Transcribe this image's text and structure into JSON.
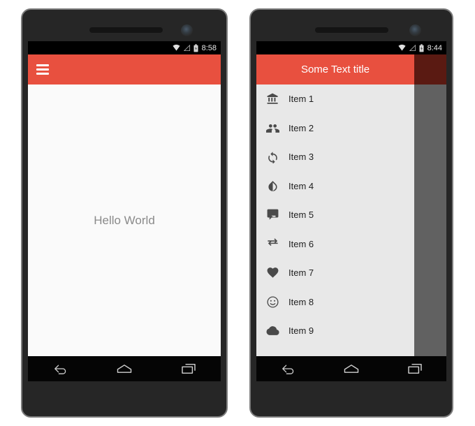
{
  "phones": [
    {
      "id": "phone-left",
      "status_bar": {
        "clock": "8:58",
        "icons": [
          "wifi-icon",
          "signal-icon",
          "battery-icon"
        ]
      },
      "app_bar": {
        "nav_icon": "hamburger-menu-icon",
        "title": ""
      },
      "content": {
        "text": "Hello World"
      },
      "nav_bar": {
        "back": "back-icon",
        "home": "home-icon",
        "recents": "recents-icon"
      }
    },
    {
      "id": "phone-right",
      "status_bar": {
        "clock": "8:44",
        "icons": [
          "wifi-icon",
          "signal-icon",
          "battery-icon"
        ]
      },
      "app_bar": {
        "title": "Some Text title"
      },
      "drawer": {
        "items": [
          {
            "label": "Item 1",
            "icon": "account-balance-icon"
          },
          {
            "label": "Item 2",
            "icon": "people-icon"
          },
          {
            "label": "Item 3",
            "icon": "autorenew-icon"
          },
          {
            "label": "Item 4",
            "icon": "opacity-icon"
          },
          {
            "label": "Item 5",
            "icon": "chat-bubbles-icon"
          },
          {
            "label": "Item 6",
            "icon": "compare-arrows-icon"
          },
          {
            "label": "Item 7",
            "icon": "favorite-heart-icon"
          },
          {
            "label": "Item 8",
            "icon": "sentiment-satisfied-icon"
          },
          {
            "label": "Item 9",
            "icon": "cloud-icon"
          }
        ]
      },
      "nav_bar": {
        "back": "back-icon",
        "home": "home-icon",
        "recents": "recents-icon"
      }
    }
  ],
  "colors": {
    "accent_red": "#E8503F",
    "scrim_red": "#5A1A12",
    "scrim_gray": "#616161",
    "drawer_bg": "#E8E8E8",
    "content_bg": "#FAFAFA",
    "phone_body": "#262626",
    "phone_outline": "#7D7D7D",
    "status_bar": "#000000",
    "nav_bar": "#050505",
    "hello_text": "#8A8A8A",
    "item_text": "#212121"
  }
}
